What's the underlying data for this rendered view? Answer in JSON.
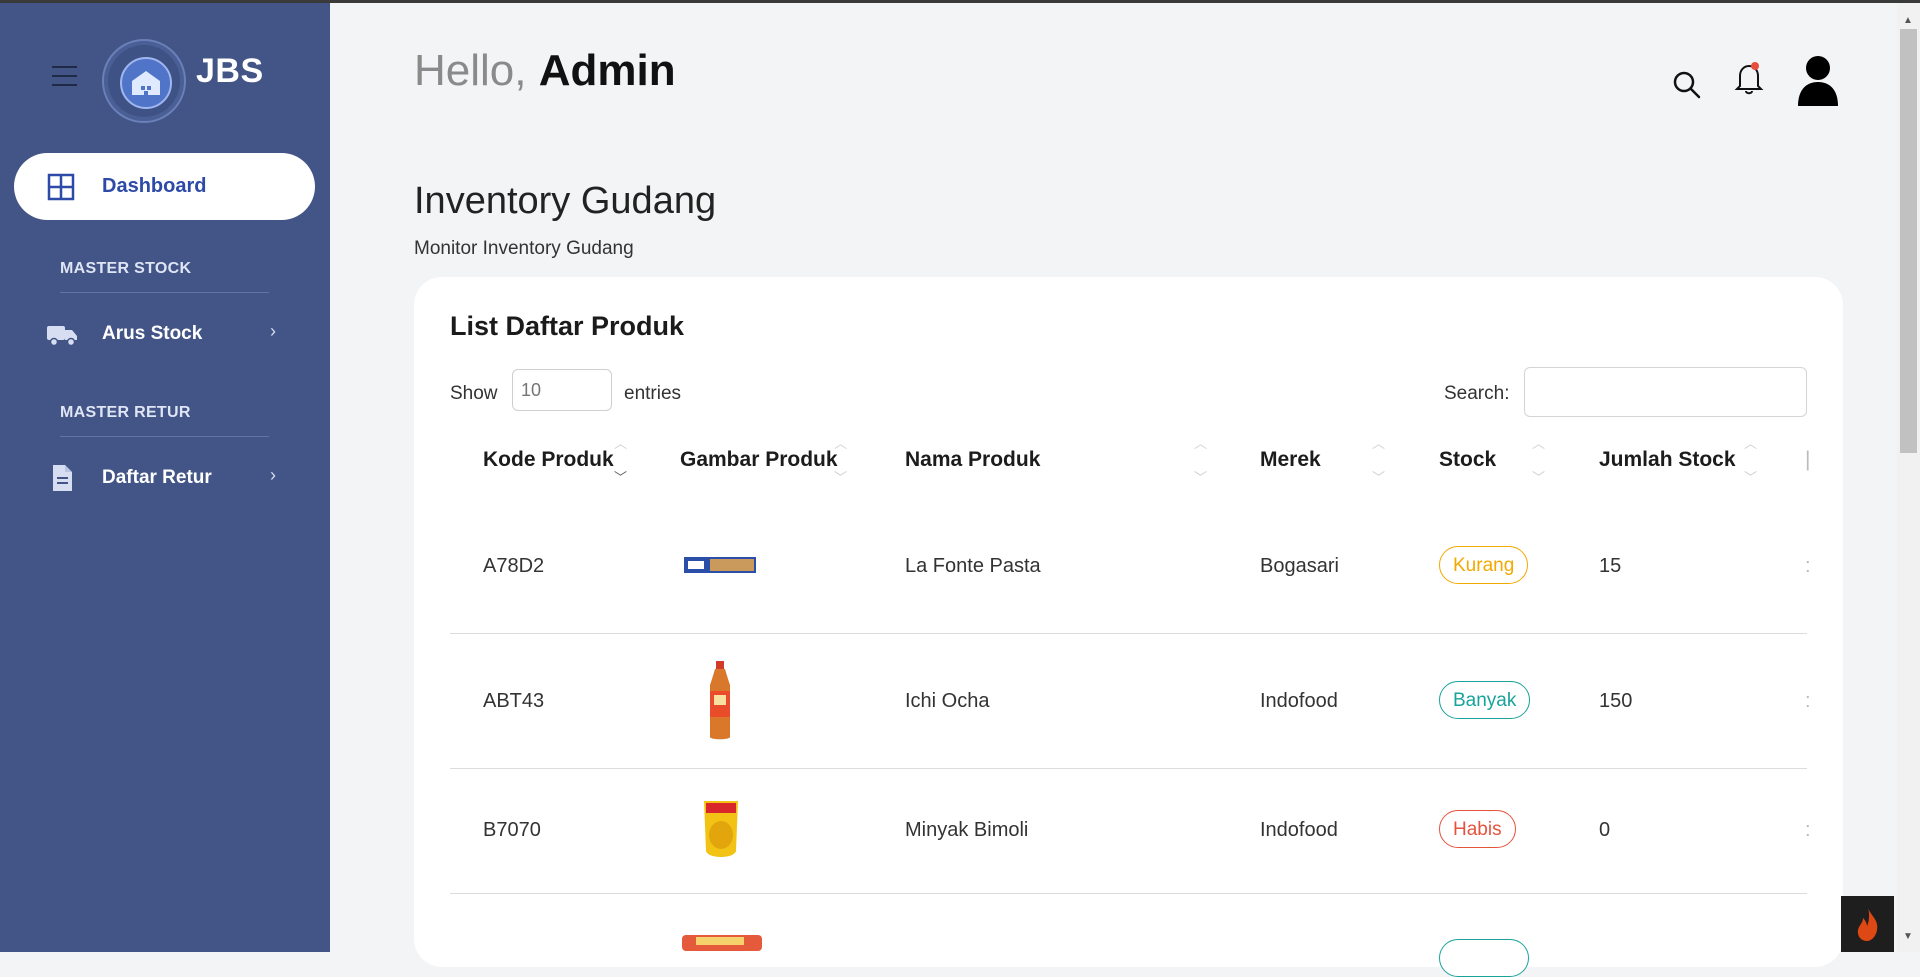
{
  "brand": {
    "name": "JBS",
    "logo_alt": "Jaya Bersama Sejahtera logo"
  },
  "sidebar": {
    "active": {
      "label": "Dashboard",
      "icon": "grid-icon"
    },
    "sections": [
      {
        "title": "MASTER STOCK",
        "items": [
          {
            "label": "Arus Stock",
            "icon": "truck-icon"
          }
        ]
      },
      {
        "title": "MASTER RETUR",
        "items": [
          {
            "label": "Daftar Retur",
            "icon": "document-icon"
          }
        ]
      }
    ]
  },
  "header": {
    "greeting": "Hello,",
    "user": "Admin",
    "icons": [
      "search-icon",
      "bell-icon",
      "user-icon"
    ],
    "notification_dot_color": "#e74c3c"
  },
  "page": {
    "title": "Inventory Gudang",
    "subtitle": "Monitor Inventory Gudang"
  },
  "table_card": {
    "title": "List Daftar Produk",
    "show_label": "Show",
    "entries_placeholder": "10",
    "entries_label": "entries",
    "search_label": "Search:",
    "columns": [
      "Kode Produk",
      "Gambar Produk",
      "Nama Produk",
      "Merek",
      "Stock",
      "Jumlah Stock"
    ],
    "rows": [
      {
        "kode": "A78D2",
        "nama": "La Fonte Pasta",
        "merek": "Bogasari",
        "stock": "Kurang",
        "jumlah": "15",
        "image": "pasta-package"
      },
      {
        "kode": "ABT43",
        "nama": "Ichi Ocha",
        "merek": "Indofood",
        "stock": "Banyak",
        "jumlah": "150",
        "image": "tea-bottle"
      },
      {
        "kode": "B7070",
        "nama": "Minyak Bimoli",
        "merek": "Indofood",
        "stock": "Habis",
        "jumlah": "0",
        "image": "oil-pouch"
      }
    ]
  },
  "colors": {
    "sidebar": "#435587",
    "accent": "#2d4aa8",
    "kurang": "#f2a900",
    "banyak": "#1aa39a",
    "habis": "#e5533d"
  }
}
